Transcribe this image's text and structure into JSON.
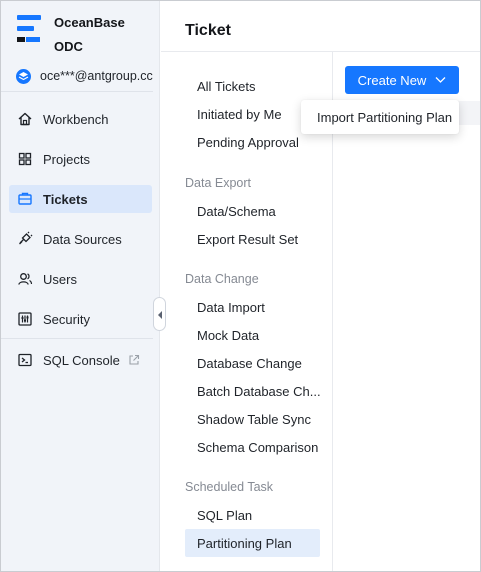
{
  "brand": {
    "line1": "OceanBase",
    "line2": "ODC"
  },
  "account": {
    "name": "oce***@antgroup.cc"
  },
  "sidebar": {
    "items": [
      {
        "label": "Workbench",
        "icon": "home-icon"
      },
      {
        "label": "Projects",
        "icon": "grid-icon"
      },
      {
        "label": "Tickets",
        "icon": "ticket-icon",
        "active": true
      },
      {
        "label": "Data Sources",
        "icon": "plug-icon"
      },
      {
        "label": "Users",
        "icon": "users-icon"
      },
      {
        "label": "Security",
        "icon": "sliders-icon"
      },
      {
        "label": "SQL Console",
        "icon": "terminal-icon",
        "external": true
      }
    ]
  },
  "main": {
    "title": "Ticket",
    "create_button": "Create New",
    "dropdown": {
      "items": [
        "Import Partitioning Plan"
      ]
    }
  },
  "ticket_nav": {
    "top_items": [
      "All Tickets",
      "Initiated by Me",
      "Pending Approval"
    ],
    "groups": [
      {
        "label": "Data Export",
        "items": [
          "Data/Schema",
          "Export Result Set"
        ]
      },
      {
        "label": "Data Change",
        "items": [
          "Data Import",
          "Mock Data",
          "Database Change",
          "Batch Database Ch...",
          "Shadow Table Sync",
          "Schema Comparison"
        ]
      },
      {
        "label": "Scheduled Task",
        "items": [
          "SQL Plan",
          "Partitioning Plan"
        ]
      }
    ],
    "active_item": "Partitioning Plan"
  },
  "colors": {
    "accent": "#1677ff",
    "sidebar_bg": "#f1f4f9",
    "active_bg": "#dae7fb"
  }
}
